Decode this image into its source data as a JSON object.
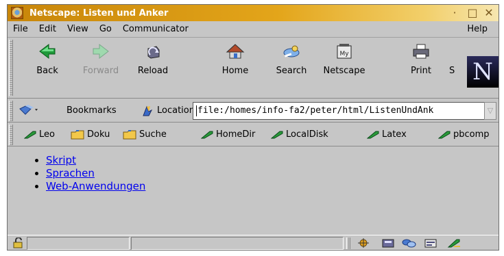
{
  "window": {
    "title": "Netscape: Listen und Anker",
    "controls": {
      "minimize": "·",
      "maximize": "□",
      "close": "✕"
    }
  },
  "menu": {
    "items": [
      "File",
      "Edit",
      "View",
      "Go",
      "Communicator"
    ],
    "help": "Help"
  },
  "navigation": {
    "buttons": [
      {
        "label": "Back",
        "icon": "back-arrow-icon",
        "enabled": true
      },
      {
        "label": "Forward",
        "icon": "forward-arrow-icon",
        "enabled": false
      },
      {
        "label": "Reload",
        "icon": "reload-icon",
        "enabled": true
      },
      {
        "label": "Home",
        "icon": "home-icon",
        "enabled": true
      },
      {
        "label": "Search",
        "icon": "search-icon",
        "enabled": true
      },
      {
        "label": "Netscape",
        "icon": "my-netscape-icon",
        "enabled": true
      },
      {
        "label": "Print",
        "icon": "print-icon",
        "enabled": true
      },
      {
        "label": "S",
        "icon": "security-icon",
        "enabled": true
      }
    ],
    "logo": "N"
  },
  "location": {
    "bookmarks_label": "Bookmarks",
    "location_label": "Location:",
    "url": "file:/homes/info-fa2/peter/html/ListenUndAnk"
  },
  "personal_toolbar": {
    "items": [
      {
        "label": "Leo",
        "icon": "bookmark-pen-icon"
      },
      {
        "label": "Doku",
        "icon": "folder-icon"
      },
      {
        "label": "Suche",
        "icon": "folder-icon"
      },
      {
        "label": "HomeDir",
        "icon": "bookmark-pen-icon"
      },
      {
        "label": "LocalDisk",
        "icon": "bookmark-pen-icon"
      },
      {
        "label": "Latex",
        "icon": "bookmark-pen-icon"
      },
      {
        "label": "pbcomp",
        "icon": "bookmark-pen-icon"
      }
    ]
  },
  "content": {
    "links": [
      "Skript",
      "Sprachen",
      "Web-Anwendungen"
    ]
  },
  "status": {
    "text": "",
    "components": [
      "navigator-icon",
      "mail-icon",
      "discussion-icon",
      "composer-icon",
      "edit-icon"
    ]
  }
}
